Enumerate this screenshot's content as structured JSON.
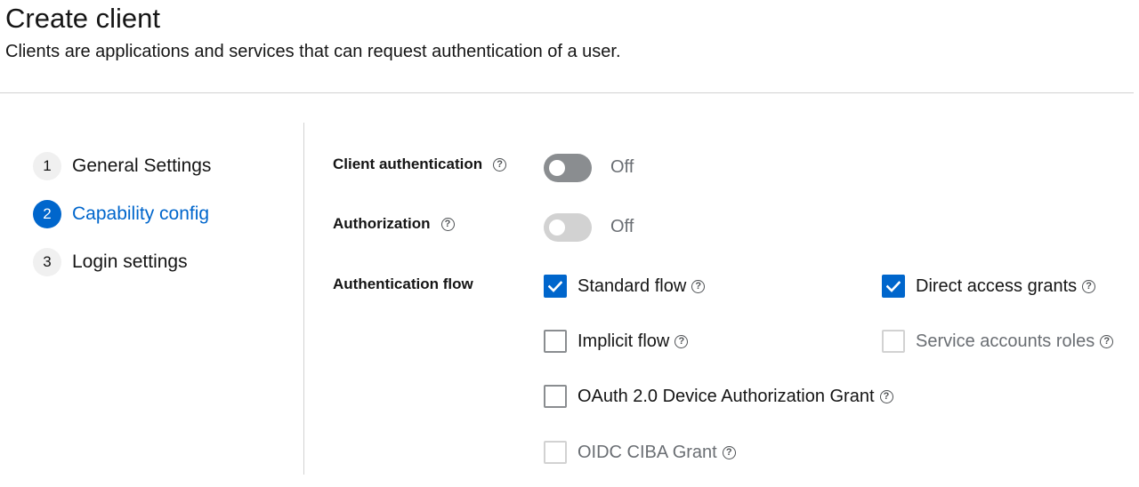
{
  "header": {
    "title": "Create client",
    "subtitle": "Clients are applications and services that can request authentication of a user."
  },
  "wizard_nav": [
    {
      "number": "1",
      "label": "General Settings",
      "current": false
    },
    {
      "number": "2",
      "label": "Capability config",
      "current": true
    },
    {
      "number": "3",
      "label": "Login settings",
      "current": false
    }
  ],
  "form": {
    "client_authentication": {
      "label": "Client authentication",
      "state": "Off",
      "enabled": true
    },
    "authorization": {
      "label": "Authorization",
      "state": "Off",
      "enabled": false
    },
    "authentication_flow": {
      "label": "Authentication flow",
      "options": [
        {
          "label": "Standard flow",
          "checked": true,
          "disabled": false
        },
        {
          "label": "Direct access grants",
          "checked": true,
          "disabled": false
        },
        {
          "label": "Implicit flow",
          "checked": false,
          "disabled": false
        },
        {
          "label": "Service accounts roles",
          "checked": false,
          "disabled": true
        },
        {
          "label": "OAuth 2.0 Device Authorization Grant",
          "checked": false,
          "disabled": false
        },
        {
          "label": "OIDC CIBA Grant",
          "checked": false,
          "disabled": true
        }
      ]
    }
  },
  "icons": {
    "help": "help-circle-icon",
    "check": "checkmark-icon"
  },
  "colors": {
    "accent": "#0066cc",
    "switch_off": "#8a8d90",
    "disabled": "#d2d2d2",
    "muted_text": "#6a6e73"
  }
}
